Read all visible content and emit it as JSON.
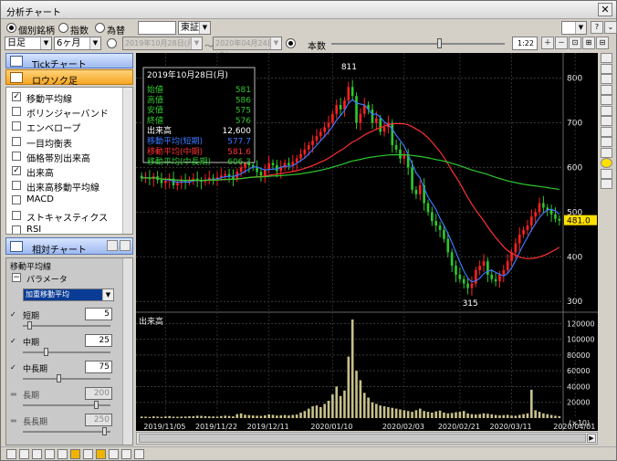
{
  "window": {
    "title": "分析チャート"
  },
  "toolbar1": {
    "radios": [
      "個別銘柄",
      "指数",
      "為替"
    ],
    "selected_radio": 0,
    "code_value": "",
    "market": "東証"
  },
  "toolbar2": {
    "period_type": "日足",
    "period_range": "6ヶ月",
    "date_from": "2019年10月28日(月)",
    "date_sep": "～",
    "date_to": "2020年04月24日(金)",
    "count_label": "本数",
    "zoom_value": "1:22"
  },
  "left_panel": {
    "tick_chart_label": "Tickチャート",
    "candlestick_label": "ロウソク足",
    "indicators": [
      {
        "label": "移動平均線",
        "checked": true
      },
      {
        "label": "ボリンジャーバンド",
        "checked": false
      },
      {
        "label": "エンベロープ",
        "checked": false
      },
      {
        "label": "一目均衡表",
        "checked": false
      },
      {
        "label": "価格帯別出来高",
        "checked": false
      },
      {
        "label": "出来高",
        "checked": true
      },
      {
        "label": "出来高移動平均線",
        "checked": false
      },
      {
        "label": "MACD",
        "checked": false
      },
      {
        "label": "ストキャスティクス",
        "checked": false
      },
      {
        "label": "RSI",
        "checked": false
      }
    ],
    "relative_chart_label": "相対チャート"
  },
  "params": {
    "title": "移動平均線",
    "section": "パラメータ",
    "method": "加重移動平均",
    "rows": [
      {
        "label": "短期",
        "value": "5",
        "enabled": true,
        "slider": 0.05
      },
      {
        "label": "中期",
        "value": "25",
        "enabled": true,
        "slider": 0.25
      },
      {
        "label": "中長期",
        "value": "75",
        "enabled": true,
        "slider": 0.4
      },
      {
        "label": "長期",
        "value": "200",
        "enabled": false,
        "slider": 0.85
      },
      {
        "label": "長長期",
        "value": "250",
        "enabled": false,
        "slider": 0.95
      }
    ]
  },
  "info_box": {
    "date": "2019年10月28日(月)",
    "rows": [
      {
        "label": "始値",
        "value": "581",
        "color": "#2ec82e"
      },
      {
        "label": "高値",
        "value": "586",
        "color": "#2ec82e"
      },
      {
        "label": "安値",
        "value": "575",
        "color": "#2ec82e"
      },
      {
        "label": "終値",
        "value": "576",
        "color": "#2ec82e"
      },
      {
        "label": "出来高",
        "value": "12,600",
        "color": "#ffffff"
      },
      {
        "label": "移動平均(短期)",
        "value": "577.7",
        "color": "#3c78ff"
      },
      {
        "label": "移動平均(中期)",
        "value": "581.6",
        "color": "#ff3030"
      },
      {
        "label": "移動平均(中長期)",
        "value": "606.3",
        "color": "#2ec82e"
      }
    ]
  },
  "chart_data": {
    "type": "candlestick",
    "price_axis": {
      "ticks": [
        800,
        700,
        600,
        500,
        400,
        300
      ],
      "min": 280,
      "max": 840
    },
    "volume_label": "出来高",
    "volume_axis": {
      "ticks": [
        120000,
        100000,
        80000,
        60000,
        40000,
        20000
      ],
      "max": 125000,
      "unit": "(×10)"
    },
    "x_ticks": [
      "2019/11/05",
      "2019/11/22",
      "2019/12/11",
      "2020/01/10",
      "2020/02/03",
      "2020/02/21",
      "2020/03/11",
      "2020/04/01"
    ],
    "x_tick_index": [
      6,
      19,
      32,
      48,
      66,
      80,
      93,
      109
    ],
    "annotations": {
      "high": "811",
      "low": "315",
      "last_price": "481.0"
    },
    "series_colors": {
      "up": "#ff2020",
      "down": "#2ec82e",
      "ma_short": "#3c78ff",
      "ma_mid": "#ff3030",
      "ma_long": "#2ec82e",
      "volume": "#c8c08a"
    },
    "closes": [
      576,
      578,
      574,
      580,
      572,
      565,
      570,
      575,
      560,
      565,
      570,
      568,
      572,
      575,
      570,
      568,
      573,
      577,
      575,
      578,
      582,
      585,
      580,
      575,
      590,
      600,
      610,
      605,
      600,
      590,
      582,
      595,
      610,
      605,
      592,
      600,
      610,
      605,
      612,
      620,
      630,
      640,
      650,
      660,
      670,
      680,
      690,
      700,
      720,
      740,
      730,
      750,
      780,
      760,
      700,
      720,
      740,
      730,
      700,
      710,
      680,
      690,
      700,
      650,
      640,
      620,
      630,
      600,
      550,
      540,
      560,
      520,
      500,
      480,
      470,
      460,
      440,
      410,
      380,
      360,
      350,
      340,
      330,
      340,
      370,
      380,
      390,
      360,
      350,
      345,
      360,
      370,
      390,
      410,
      430,
      450,
      460,
      470,
      490,
      500,
      520,
      510,
      505,
      495,
      485,
      481
    ],
    "volumes": [
      2000,
      1800,
      1500,
      2200,
      1900,
      1600,
      2100,
      2500,
      1800,
      1700,
      1900,
      2000,
      2300,
      2400,
      3000,
      2800,
      2500,
      2200,
      2100,
      1900,
      2600,
      3100,
      2700,
      2200,
      5000,
      6000,
      4200,
      3800,
      3300,
      3000,
      2800,
      3500,
      4800,
      4100,
      3200,
      3500,
      3900,
      3300,
      4000,
      4500,
      7000,
      9000,
      12000,
      15000,
      16000,
      14000,
      18000,
      22000,
      30000,
      40000,
      28000,
      35000,
      78000,
      125000,
      60000,
      48000,
      32000,
      26000,
      20000,
      18000,
      16000,
      15000,
      14000,
      13000,
      12000,
      11000,
      10000,
      9000,
      8000,
      10000,
      12000,
      9000,
      8000,
      7000,
      8500,
      9500,
      7000,
      6000,
      6500,
      7500,
      8000,
      9000,
      6000,
      5000,
      4500,
      5000,
      6000,
      5500,
      4800,
      4000,
      3500,
      3800,
      4200,
      3200,
      3000,
      4000,
      5000,
      6000,
      36000,
      10000,
      8000,
      6000,
      5000,
      4000,
      3000,
      2500
    ]
  }
}
